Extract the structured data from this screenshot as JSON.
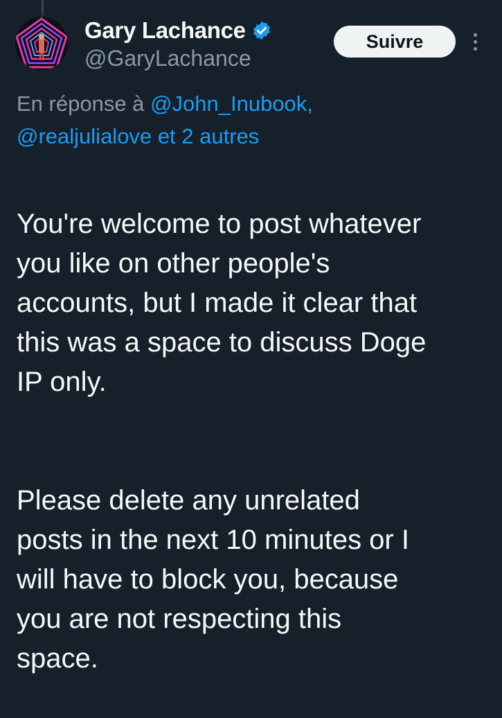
{
  "author": {
    "display_name": "Gary Lachance",
    "handle": "@GaryLachance",
    "verified": true,
    "avatar": "neon-pentagon-tunnel-avatar"
  },
  "actions": {
    "follow_label": "Suivre",
    "more_icon": "more-vertical-icon"
  },
  "reply_context": {
    "prefix": "En réponse à",
    "mention_1": "@John_Inubook,",
    "mention_2": "@realjulialove",
    "connector": "et",
    "others": "2 autres"
  },
  "tweet": {
    "paragraph_1": "You're welcome to post whatever\nyou like on other people's\naccounts, but I made it clear that\nthis was a space to discuss Doge\nIP only.",
    "paragraph_2": "Please delete any unrelated\nposts in the next 10 minutes or I\nwill have to block you, because\nyou are not respecting this\nspace."
  },
  "colors": {
    "background": "#15202b",
    "text_primary": "#f7f9f9",
    "text_secondary": "#8b98a5",
    "accent": "#1d9bf0",
    "button_bg": "#eff3f4"
  }
}
